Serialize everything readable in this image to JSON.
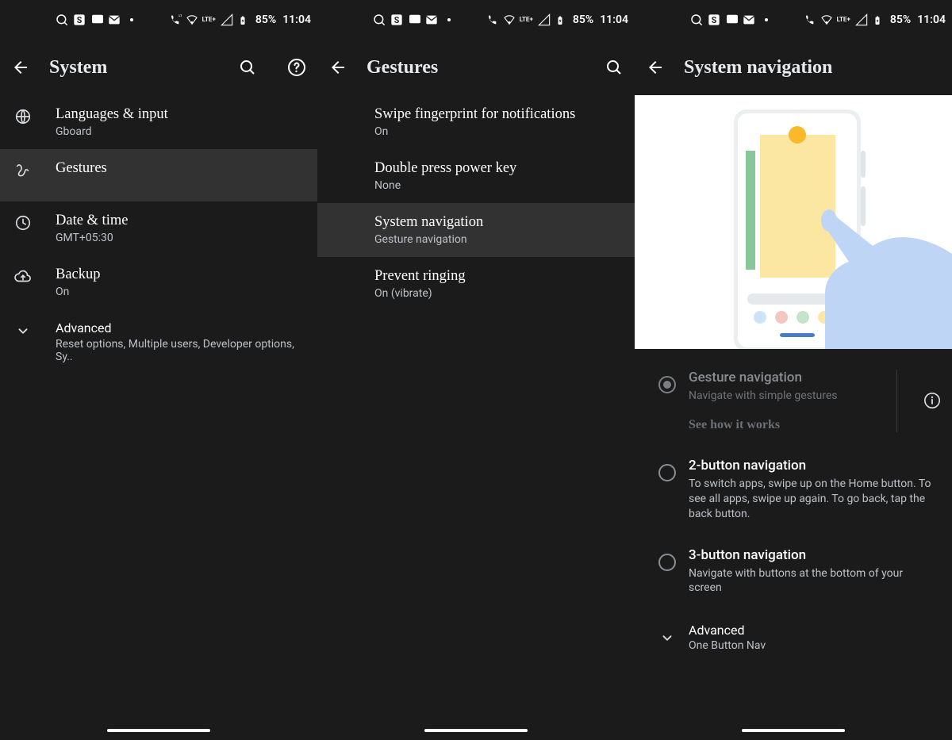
{
  "status": {
    "battery_text": "85%",
    "time": "11:04"
  },
  "screen1": {
    "title": "System",
    "items": {
      "languages": {
        "primary": "Languages & input",
        "secondary": "Gboard"
      },
      "gestures": {
        "primary": "Gestures"
      },
      "datetime": {
        "primary": "Date & time",
        "secondary": "GMT+05:30"
      },
      "backup": {
        "primary": "Backup",
        "secondary": "On"
      },
      "advanced": {
        "primary": "Advanced",
        "secondary": "Reset options, Multiple users, Developer options, Sy.."
      }
    }
  },
  "screen2": {
    "title": "Gestures",
    "items": {
      "swipe": {
        "primary": "Swipe fingerprint for notifications",
        "secondary": "On"
      },
      "double": {
        "primary": "Double press power key",
        "secondary": "None"
      },
      "sysnav": {
        "primary": "System navigation",
        "secondary": "Gesture navigation"
      },
      "prevent": {
        "primary": "Prevent ringing",
        "secondary": "On (vibrate)"
      }
    }
  },
  "screen3": {
    "title": "System navigation",
    "options": {
      "gesture": {
        "primary": "Gesture navigation",
        "secondary": "Navigate with simple gestures",
        "link": "See how it works"
      },
      "two_button": {
        "primary": "2-button navigation",
        "secondary": "To switch apps, swipe up on the Home button. To see all apps, swipe up again. To go back, tap the back button."
      },
      "three_button": {
        "primary": "3-button navigation",
        "secondary": "Navigate with buttons at the bottom of your screen"
      }
    },
    "advanced": {
      "primary": "Advanced",
      "secondary": "One Button Nav"
    }
  }
}
